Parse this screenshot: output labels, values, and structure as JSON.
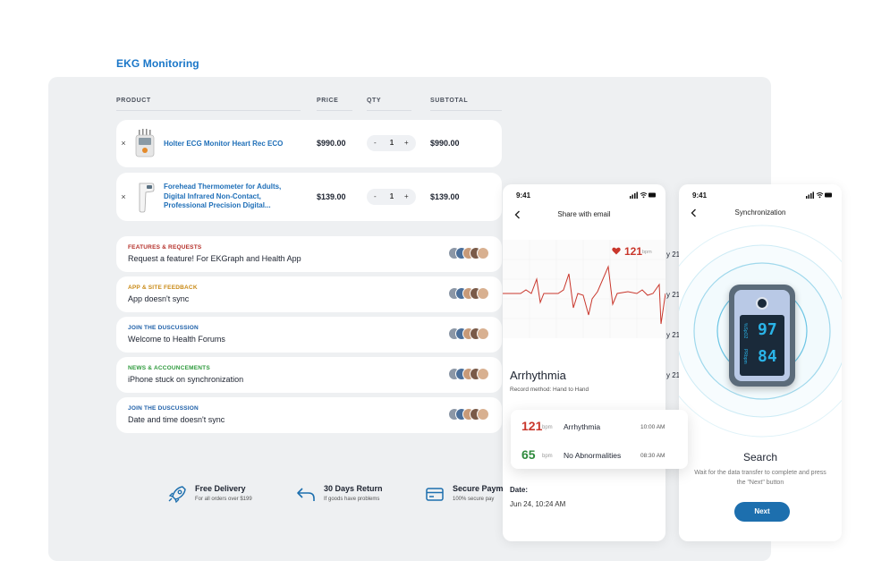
{
  "page": {
    "title": "EKG Monitoring"
  },
  "cart": {
    "headers": {
      "product": "PRODUCT",
      "price": "PRICE",
      "qty": "QTY",
      "subtotal": "SUBTOTAL"
    },
    "items": [
      {
        "name_lines": [
          "Holter ECG Monitor Heart Rec ECO"
        ],
        "price": "$990.00",
        "qty": "1",
        "subtotal": "$990.00",
        "minus": "-",
        "plus": "+",
        "remove": "×"
      },
      {
        "name_lines": [
          "Forehead Thermometer for Adults,",
          "Digital Infrared Non-Contact,",
          "Professional Precision Digital..."
        ],
        "price": "$139.00",
        "qty": "1",
        "subtotal": "$139.00",
        "minus": "-",
        "plus": "+",
        "remove": "×"
      }
    ]
  },
  "forum": {
    "topics": [
      {
        "category": "FEATURES & REQUESTS",
        "category_color": "#b5302a",
        "title": "Request a feature! For EKGraph and Health App"
      },
      {
        "category": "APP & SITE FEEDBACK",
        "category_color": "#c98a16",
        "title": "App doesn't sync"
      },
      {
        "category": "JOIN THE DUSCUSSION",
        "category_color": "#1d5fa8",
        "title": "Welcome to Health Forums"
      },
      {
        "category": "NEWS & ACCOUNCEMENTS",
        "category_color": "#2e9a3c",
        "title": "iPhone stuck on synchronization"
      },
      {
        "category": "JOIN THE DUSCUSSION",
        "category_color": "#1d5fa8",
        "title": "Date and time doesn't sync"
      }
    ]
  },
  "features": [
    {
      "title": "Free Delivery",
      "subtitle": "For all orders over $199",
      "icon": "rocket-icon"
    },
    {
      "title": "30 Days Return",
      "subtitle": "If goods have problems",
      "icon": "return-arrow-icon"
    },
    {
      "title": "Secure Paym",
      "subtitle": "100% secure pay",
      "icon": "credit-card-icon"
    }
  ],
  "phone1": {
    "time": "9:41",
    "title": "Share with email",
    "heart_rate": "121",
    "heart_unit": "bpm",
    "diagnosis": "Arrhythmia",
    "record_method": "Record method: Hand to Hand",
    "date_label": "Date:",
    "date_value": "Jun 24, 10:24 AM"
  },
  "readings": [
    {
      "value": "121",
      "unit": "bpm",
      "label": "Arrhythmia",
      "time": "10:00 AM",
      "color": "#c9372c"
    },
    {
      "value": "65",
      "unit": "bpm",
      "label": "No Abnormalities",
      "time": "08:30 AM",
      "color": "#2e8a3c"
    }
  ],
  "peek_values": [
    "y 21",
    "y 21",
    "y 21",
    "y 21"
  ],
  "phone2": {
    "time": "9:41",
    "title": "Synchronization",
    "device_spo2": "97",
    "device_pr": "84",
    "device_label_spo2": "%SpO2",
    "device_label_pr": "PRbpm",
    "search_title": "Search",
    "search_subtitle": "Wait for the data transfer to complete and press the \"Next\" button",
    "next_label": "Next"
  },
  "colors": {
    "accent": "#1976c8",
    "button": "#1d6fae",
    "device_screen": "#1a2a3a",
    "device_digits": "#2ab4e8"
  }
}
